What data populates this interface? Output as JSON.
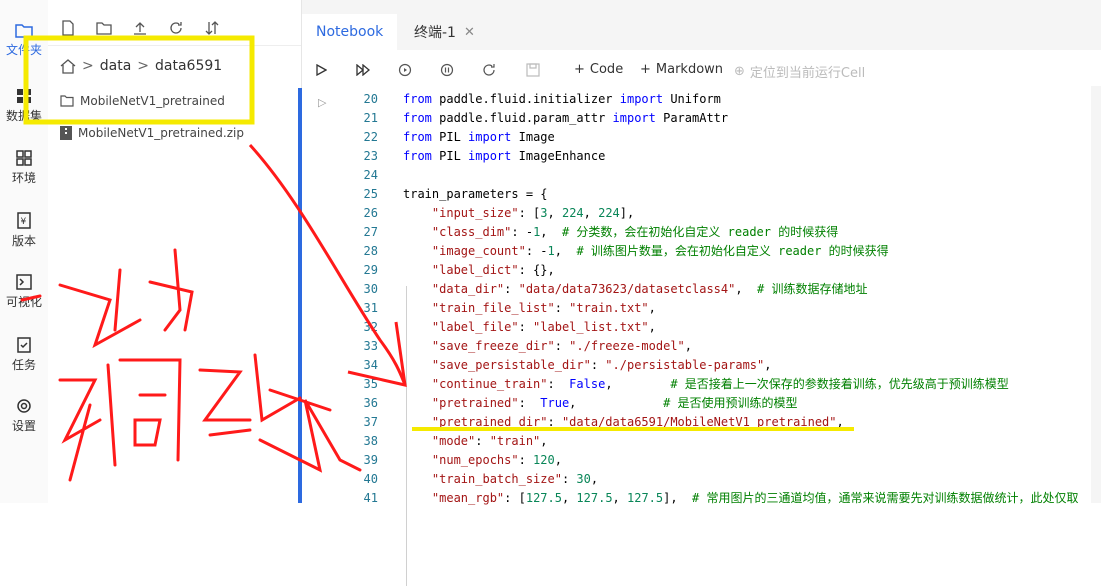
{
  "nav": [
    {
      "label": "文件夹",
      "icon": "folder-icon"
    },
    {
      "label": "数据集",
      "icon": "dataset-icon"
    },
    {
      "label": "环境",
      "icon": "grid-icon"
    },
    {
      "label": "版本",
      "icon": "version-icon"
    },
    {
      "label": "可视化",
      "icon": "terminal-icon"
    },
    {
      "label": "任务",
      "icon": "task-icon"
    },
    {
      "label": "设置",
      "icon": "gear-icon"
    }
  ],
  "breadcrumb": {
    "part1": "data",
    "sep": ">",
    "part2": "data6591"
  },
  "files": [
    {
      "name": "MobileNetV1_pretrained",
      "type": "folder-icon"
    },
    {
      "name": "MobileNetV1_pretrained.zip",
      "type": "zip-icon"
    }
  ],
  "tabs": [
    {
      "label": "Notebook"
    },
    {
      "label": "终端-1"
    }
  ],
  "toolbar": {
    "code_label": "Code",
    "markdown_label": "Markdown",
    "locate_label": "定位到当前运行Cell"
  },
  "accent_color": "#2d6ae0",
  "annotation_color": "#ff1a1a",
  "highlight_color": "#f5ea00",
  "code_lines": [
    {
      "n": "20",
      "segs": [
        [
          "kw",
          "from"
        ],
        [
          "",
          "paddle.fluid.initializer"
        ],
        [
          "kw",
          "import"
        ],
        [
          "",
          "Uniform"
        ]
      ]
    },
    {
      "n": "21",
      "segs": [
        [
          "kw",
          "from"
        ],
        [
          "",
          "paddle.fluid.param_attr"
        ],
        [
          "kw",
          "import"
        ],
        [
          "",
          "ParamAttr"
        ]
      ]
    },
    {
      "n": "22",
      "segs": [
        [
          "kw",
          "from"
        ],
        [
          "",
          "PIL"
        ],
        [
          "kw",
          "import"
        ],
        [
          "",
          "Image"
        ]
      ]
    },
    {
      "n": "23",
      "segs": [
        [
          "kw",
          "from"
        ],
        [
          "",
          "PIL"
        ],
        [
          "kw",
          "import"
        ],
        [
          "",
          "ImageEnhance"
        ]
      ]
    },
    {
      "n": "24",
      "segs": []
    },
    {
      "n": "25",
      "segs": [
        [
          "",
          "train_parameters = {"
        ]
      ]
    },
    {
      "n": "26",
      "segs": [
        [
          "str",
          "    \"input_size\""
        ],
        [
          "",
          ": ["
        ],
        [
          "num",
          "3"
        ],
        [
          "",
          ", "
        ],
        [
          "num",
          "224"
        ],
        [
          "",
          ", "
        ],
        [
          "num",
          "224"
        ],
        [
          "",
          "],"
        ]
      ]
    },
    {
      "n": "27",
      "segs": [
        [
          "str",
          "    \"class_dim\""
        ],
        [
          "",
          ": -"
        ],
        [
          "num",
          "1"
        ],
        [
          "",
          ",  "
        ],
        [
          "cmt",
          "# 分类数，会在初始化自定义 reader 的时候获得"
        ]
      ]
    },
    {
      "n": "28",
      "segs": [
        [
          "str",
          "    \"image_count\""
        ],
        [
          "",
          ": -"
        ],
        [
          "num",
          "1"
        ],
        [
          "",
          ",  "
        ],
        [
          "cmt",
          "# 训练图片数量，会在初始化自定义 reader 的时候获得"
        ]
      ]
    },
    {
      "n": "29",
      "segs": [
        [
          "str",
          "    \"label_dict\""
        ],
        [
          "",
          ": {},"
        ]
      ]
    },
    {
      "n": "30",
      "segs": [
        [
          "str",
          "    \"data_dir\""
        ],
        [
          "",
          ": "
        ],
        [
          "str",
          "\"data/data73623/datasetclass4\""
        ],
        [
          "",
          ",  "
        ],
        [
          "cmt",
          "# 训练数据存储地址"
        ]
      ]
    },
    {
      "n": "31",
      "segs": [
        [
          "str",
          "    \"train_file_list\""
        ],
        [
          "",
          ": "
        ],
        [
          "str",
          "\"train.txt\""
        ],
        [
          "",
          ","
        ]
      ]
    },
    {
      "n": "32",
      "segs": [
        [
          "str",
          "    \"label_file\""
        ],
        [
          "",
          ": "
        ],
        [
          "str",
          "\"label_list.txt\""
        ],
        [
          "",
          ","
        ]
      ]
    },
    {
      "n": "33",
      "segs": [
        [
          "str",
          "    \"save_freeze_dir\""
        ],
        [
          "",
          ": "
        ],
        [
          "str",
          "\"./freeze-model\""
        ],
        [
          "",
          ","
        ]
      ]
    },
    {
      "n": "34",
      "segs": [
        [
          "str",
          "    \"save_persistable_dir\""
        ],
        [
          "",
          ": "
        ],
        [
          "str",
          "\"./persistable-params\""
        ],
        [
          "",
          ","
        ]
      ]
    },
    {
      "n": "35",
      "segs": [
        [
          "str",
          "    \"continue_train\""
        ],
        [
          "",
          ": "
        ],
        [
          "kw",
          "False"
        ],
        [
          "",
          ",        "
        ],
        [
          "cmt",
          "# 是否接着上一次保存的参数接着训练，优先级高于预训练模型"
        ]
      ]
    },
    {
      "n": "36",
      "segs": [
        [
          "str",
          "    \"pretrained\""
        ],
        [
          "",
          ": "
        ],
        [
          "kw",
          "True"
        ],
        [
          "",
          ",            "
        ],
        [
          "cmt",
          "# 是否使用预训练的模型"
        ]
      ]
    },
    {
      "n": "37",
      "segs": [
        [
          "str",
          "    \"pretrained_dir\""
        ],
        [
          "",
          ": "
        ],
        [
          "str",
          "\"data/data6591/MobileNetV1_pretrained\""
        ],
        [
          "",
          ","
        ]
      ]
    },
    {
      "n": "38",
      "segs": [
        [
          "str",
          "    \"mode\""
        ],
        [
          "",
          ": "
        ],
        [
          "str",
          "\"train\""
        ],
        [
          "",
          ","
        ]
      ]
    },
    {
      "n": "39",
      "segs": [
        [
          "str",
          "    \"num_epochs\""
        ],
        [
          "",
          ": "
        ],
        [
          "num",
          "120"
        ],
        [
          "",
          ","
        ]
      ]
    },
    {
      "n": "40",
      "segs": [
        [
          "str",
          "    \"train_batch_size\""
        ],
        [
          "",
          ": "
        ],
        [
          "num",
          "30"
        ],
        [
          "",
          ","
        ]
      ]
    },
    {
      "n": "41",
      "segs": [
        [
          "str",
          "    \"mean_rgb\""
        ],
        [
          "",
          ": ["
        ],
        [
          "num",
          "127.5"
        ],
        [
          "",
          ", "
        ],
        [
          "num",
          "127.5"
        ],
        [
          "",
          ", "
        ],
        [
          "num",
          "127.5"
        ],
        [
          "",
          "],  "
        ],
        [
          "cmt",
          "# 常用图片的三通道均值，通常来说需要先对训练数据做统计，此处仅取"
        ]
      ]
    }
  ]
}
